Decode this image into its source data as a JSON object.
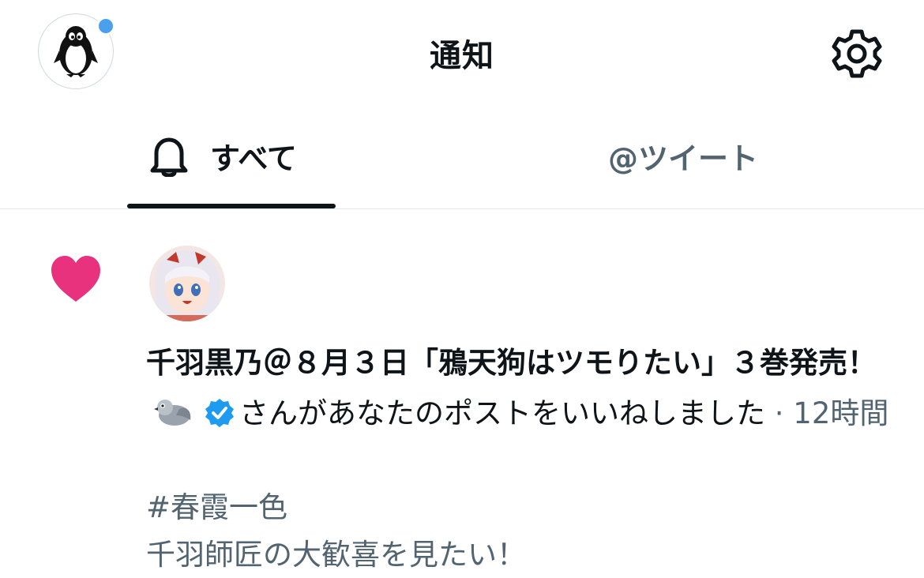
{
  "header": {
    "title": "通知",
    "avatar_icon": "penguin-icon",
    "settings_icon": "gear-icon",
    "notification_dot_color": "#4a9fee"
  },
  "tabs": [
    {
      "label": "すべて",
      "icon": "bell-icon",
      "active": true
    },
    {
      "label": "@ツイート",
      "active": false
    }
  ],
  "notification": {
    "type_icon": "heart-icon",
    "type_color": "#e8327d",
    "user_name": "千羽黒乃＠８月３日「鴉天狗はツモりたい」３巻発売！",
    "action_text": "さんがあなたのポストをいいねしました",
    "separator": "·",
    "time": "12時間",
    "tweet_hashtag": "#春霞一色",
    "tweet_body": "千羽師匠の大歓喜を見たい！"
  }
}
